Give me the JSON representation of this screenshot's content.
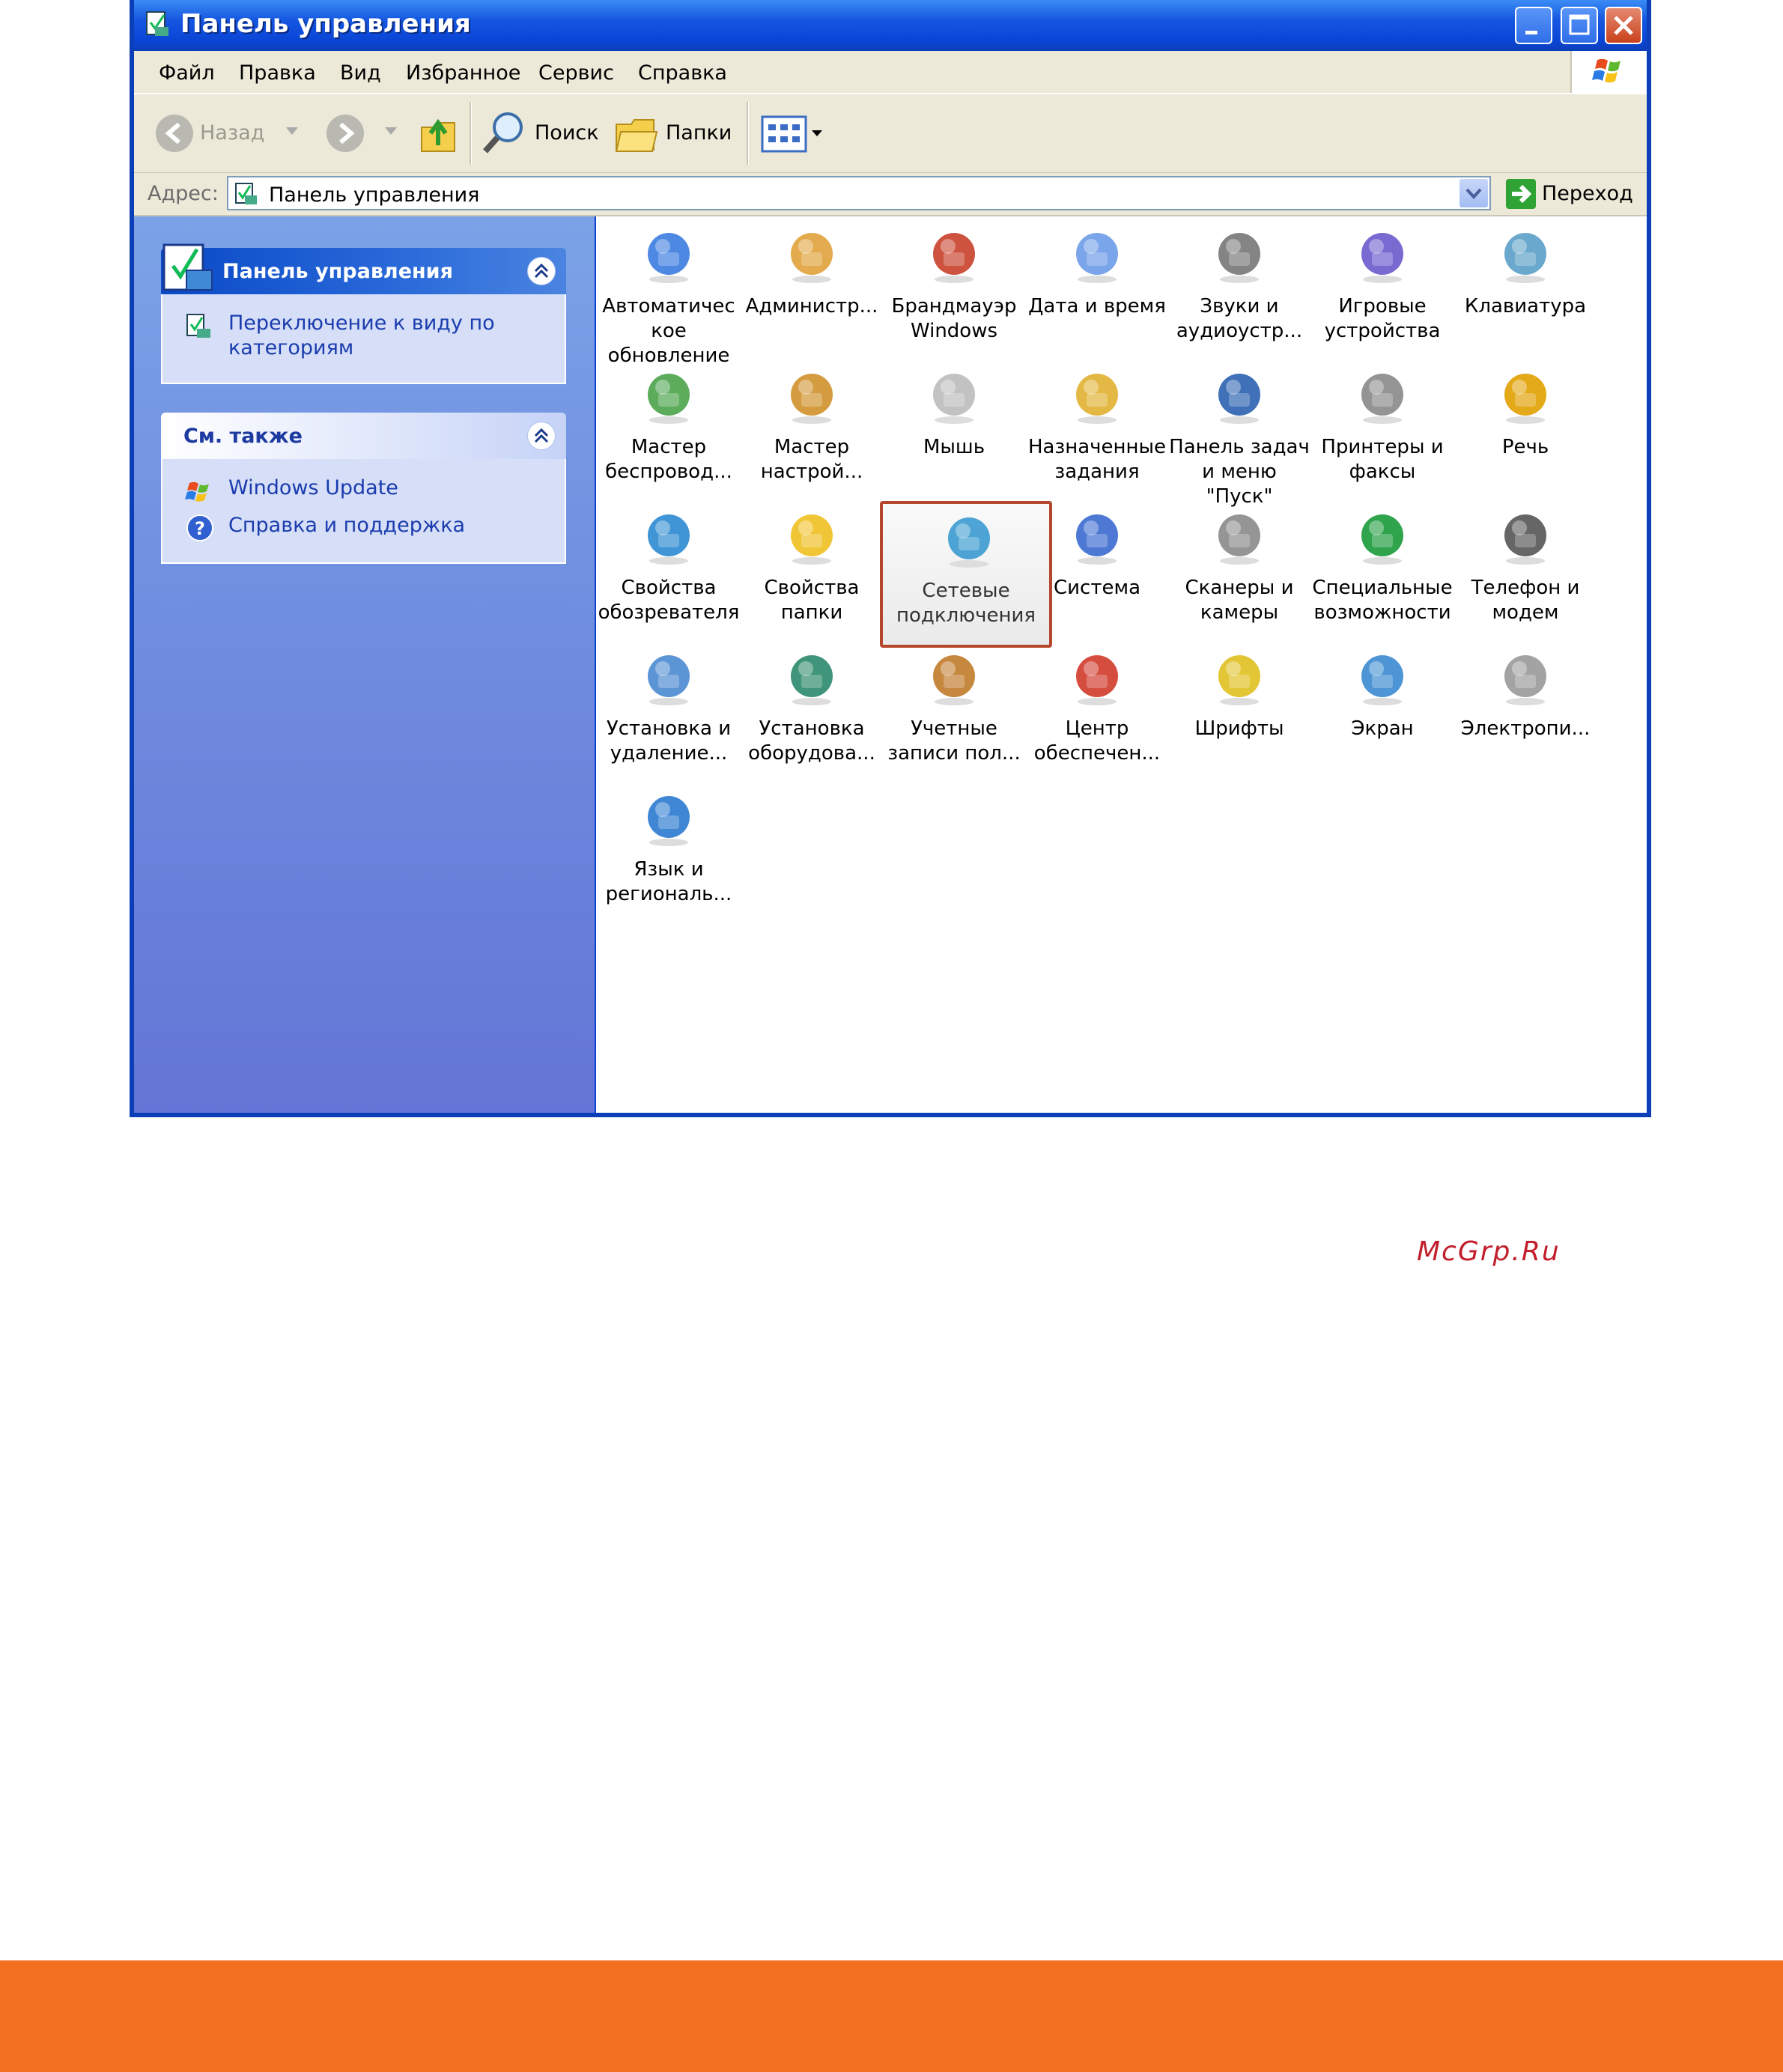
{
  "window": {
    "title": "Панель управления",
    "menu": [
      "Файл",
      "Правка",
      "Вид",
      "Избранное",
      "Сервис",
      "Справка"
    ]
  },
  "toolbar": {
    "back_label": "Назад",
    "search_label": "Поиск",
    "folders_label": "Папки"
  },
  "address": {
    "label": "Адрес:",
    "value": "Панель управления",
    "go_label": "Переход"
  },
  "taskpane": {
    "control_panel": {
      "title": "Панель управления",
      "link": "Переключение к виду по категориям"
    },
    "see_also": {
      "title": "См. также",
      "links": [
        "Windows Update",
        "Справка и поддержка"
      ]
    }
  },
  "items": [
    {
      "label": "Автоматичес\nкое\nобновление",
      "icon": "automatic-updates-icon"
    },
    {
      "label": "Администр...",
      "icon": "administrative-tools-icon"
    },
    {
      "label": "Брандмауэр\nWindows",
      "icon": "windows-firewall-icon"
    },
    {
      "label": "Дата и время",
      "icon": "date-time-icon"
    },
    {
      "label": "Звуки и\nаудиоустр...",
      "icon": "sounds-audio-icon"
    },
    {
      "label": "Игровые\nустройства",
      "icon": "game-controllers-icon"
    },
    {
      "label": "Клавиатура",
      "icon": "keyboard-icon"
    },
    {
      "label": "Мастер\nбеспровод...",
      "icon": "wireless-wizard-icon"
    },
    {
      "label": "Мастер\nнастрой...",
      "icon": "network-setup-wizard-icon"
    },
    {
      "label": "Мышь",
      "icon": "mouse-icon"
    },
    {
      "label": "Назначенные\nзадания",
      "icon": "scheduled-tasks-icon"
    },
    {
      "label": "Панель задач\nи меню \"Пуск\"",
      "icon": "taskbar-start-menu-icon"
    },
    {
      "label": "Принтеры и\nфаксы",
      "icon": "printers-faxes-icon"
    },
    {
      "label": "Речь",
      "icon": "speech-icon"
    },
    {
      "label": "Свойства\nобозревателя",
      "icon": "internet-options-icon"
    },
    {
      "label": "Свойства\nпапки",
      "icon": "folder-options-icon"
    },
    {
      "label": "Сетевые\nподключения",
      "icon": "network-connections-icon",
      "selected": true
    },
    {
      "label": "Система",
      "icon": "system-icon"
    },
    {
      "label": "Сканеры и\nкамеры",
      "icon": "scanners-cameras-icon"
    },
    {
      "label": "Специальные\nвозможности",
      "icon": "accessibility-icon"
    },
    {
      "label": "Телефон и\nмодем",
      "icon": "phone-modem-icon"
    },
    {
      "label": "Установка и\nудаление...",
      "icon": "add-remove-programs-icon"
    },
    {
      "label": "Установка\nоборудова...",
      "icon": "add-hardware-icon"
    },
    {
      "label": "Учетные\nзаписи пол...",
      "icon": "user-accounts-icon"
    },
    {
      "label": "Центр\nобеспечен...",
      "icon": "security-center-icon"
    },
    {
      "label": "Шрифты",
      "icon": "fonts-icon"
    },
    {
      "label": "Экран",
      "icon": "display-icon"
    },
    {
      "label": "Электропи...",
      "icon": "power-options-icon"
    },
    {
      "label": "Язык и\nрегиональ...",
      "icon": "regional-language-icon"
    }
  ],
  "watermark": "McGrp.Ru",
  "colors": {
    "titlebar": "#0a45d6",
    "selection_border": "#b5472c",
    "footer_band": "#f37021",
    "watermark": "#c21e2b"
  }
}
